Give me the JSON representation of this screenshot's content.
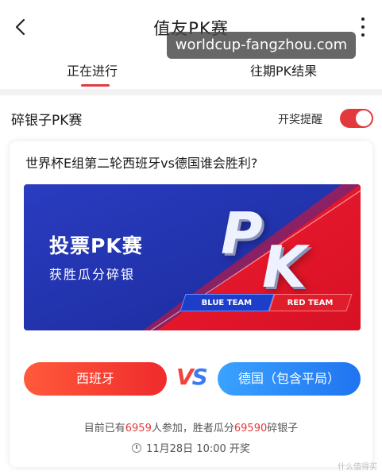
{
  "header": {
    "title": "值友PK赛",
    "watermark": "worldcup-fangzhou.com"
  },
  "tabs": [
    {
      "label": "正在进行",
      "active": true
    },
    {
      "label": "往期PK结果",
      "active": false
    }
  ],
  "section": {
    "title": "碎银子PK赛",
    "remind_label": "开奖提醒",
    "remind_on": true
  },
  "question": "世界杯E组第二轮西班牙vs德国谁会胜利?",
  "banner": {
    "title": "投票PK赛",
    "subtitle": "获胜瓜分碎银",
    "pk_p": "P",
    "pk_k": "K",
    "blue_team": "BLUE TEAM",
    "red_team": "RED TEAM"
  },
  "vote": {
    "left_option": "西班牙",
    "vs_v": "V",
    "vs_s": "S",
    "right_option": "德国（包含平局）"
  },
  "stats": {
    "prefix": "目前已有",
    "participants": "6959",
    "middle": "人参加，胜者瓜分",
    "prize": "69590",
    "suffix": "碎银子"
  },
  "draw_time": "11月28日 10:00 开奖",
  "corner_mark": "什么值得买",
  "colors": {
    "accent_red": "#e4393c",
    "blue": "#1f74f0"
  }
}
